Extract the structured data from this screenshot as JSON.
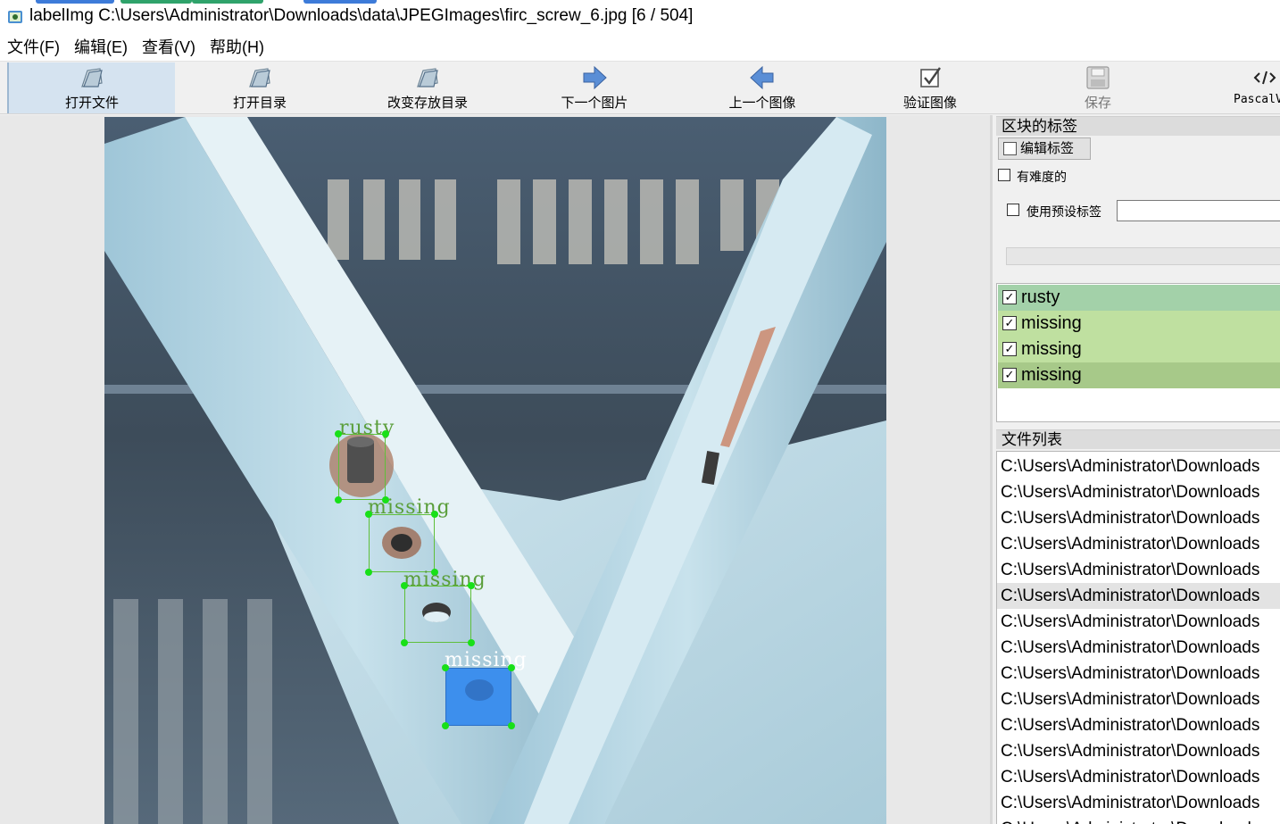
{
  "title_bar": {
    "text": "labelImg C:\\Users\\Administrator\\Downloads\\data\\JPEGImages\\firc_screw_6.jpg [6 / 504]",
    "icon": "labelimg-app-icon"
  },
  "menu": [
    "文件(F)",
    "编辑(E)",
    "查看(V)",
    "帮助(H)"
  ],
  "toolbar": [
    {
      "label": "打开文件",
      "icon": "folder-icon",
      "active": true
    },
    {
      "label": "打开目录",
      "icon": "folder-icon"
    },
    {
      "label": "改变存放目录",
      "icon": "folder-icon"
    },
    {
      "label": "下一个图片",
      "icon": "arrow-right-icon"
    },
    {
      "label": "上一个图像",
      "icon": "arrow-left-icon"
    },
    {
      "label": "验证图像",
      "icon": "verify-check-icon"
    },
    {
      "label": "保存",
      "icon": "save-disk-icon",
      "disabled": true
    },
    {
      "label": "PascalVOC",
      "icon": "code-tag-icon"
    }
  ],
  "annotations": [
    {
      "label": "rusty",
      "selected": false
    },
    {
      "label": "missing",
      "selected": false
    },
    {
      "label": "missing",
      "selected": false
    },
    {
      "label": "missing",
      "selected": true
    }
  ],
  "dock": {
    "box_labels_title": "区块的标签",
    "edit_label_button": "编辑标签",
    "difficult_label": "有难度的",
    "use_default_label": "使用预设标签",
    "default_label_value": "",
    "labels": [
      {
        "text": "rusty",
        "checked": true,
        "color": "#a3d1a9"
      },
      {
        "text": "missing",
        "checked": true,
        "color": "#bfe0a0"
      },
      {
        "text": "missing",
        "checked": true,
        "color": "#bfe0a0"
      },
      {
        "text": "missing",
        "checked": true,
        "color": "#a7c989"
      }
    ],
    "file_list_title": "文件列表",
    "files": [
      "C:\\Users\\Administrator\\Downloads",
      "C:\\Users\\Administrator\\Downloads",
      "C:\\Users\\Administrator\\Downloads",
      "C:\\Users\\Administrator\\Downloads",
      "C:\\Users\\Administrator\\Downloads",
      "C:\\Users\\Administrator\\Downloads",
      "C:\\Users\\Administrator\\Downloads",
      "C:\\Users\\Administrator\\Downloads",
      "C:\\Users\\Administrator\\Downloads",
      "C:\\Users\\Administrator\\Downloads",
      "C:\\Users\\Administrator\\Downloads",
      "C:\\Users\\Administrator\\Downloads",
      "C:\\Users\\Administrator\\Downloads",
      "C:\\Users\\Administrator\\Downloads",
      "C:\\Users\\Administrator\\Downloads"
    ],
    "current_file_index": 5
  }
}
